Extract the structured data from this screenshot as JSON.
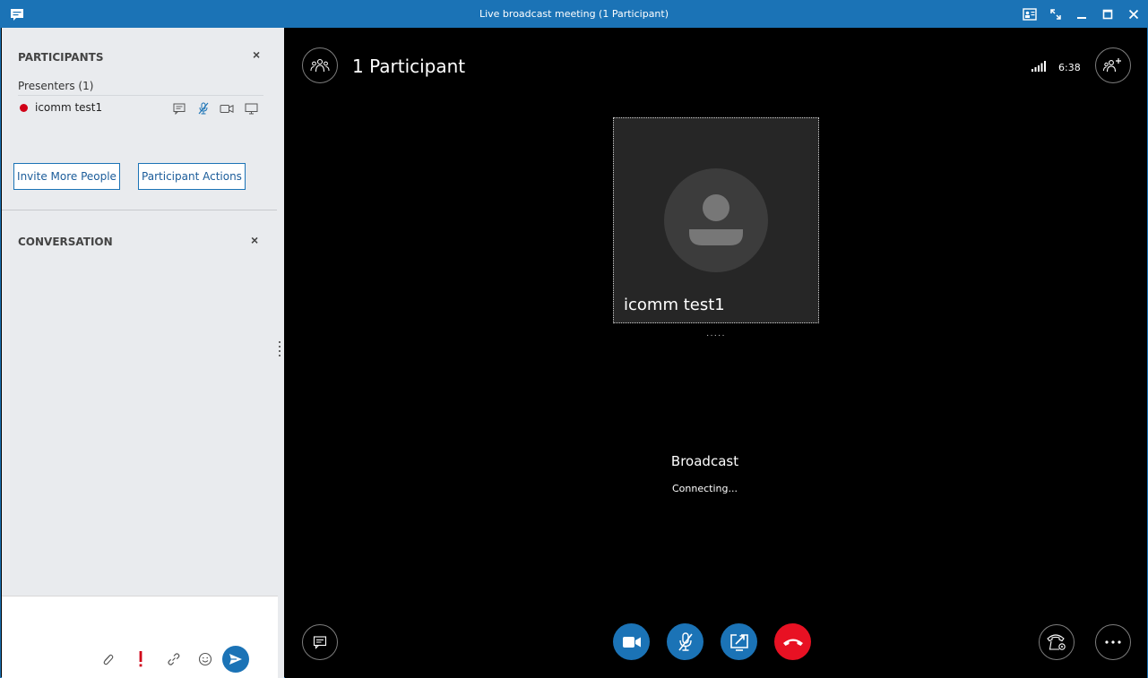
{
  "window": {
    "title": "Live broadcast meeting (1 Participant)"
  },
  "participants_panel": {
    "heading": "PARTICIPANTS",
    "close": "×",
    "presenters_label": "Presenters (1)",
    "participants": [
      {
        "name": "icomm test1",
        "status_color": "#d00017"
      }
    ],
    "invite_button": "Invite More People",
    "actions_button": "Participant Actions"
  },
  "conversation_panel": {
    "heading": "CONVERSATION",
    "close": "×",
    "compose_icons": [
      "attachment-icon",
      "importance-icon",
      "link-icon",
      "emoticon-icon",
      "send-icon"
    ]
  },
  "stage": {
    "participant_count": "1 Participant",
    "call_timer": "6:38",
    "tile_name": "icomm test1",
    "broadcast_title": "Broadcast",
    "broadcast_status": "Connecting...",
    "controls": [
      {
        "name": "video",
        "color": "#1b73b6"
      },
      {
        "name": "mute",
        "color": "#1b73b6"
      },
      {
        "name": "share",
        "color": "#1b73b6"
      },
      {
        "name": "hang-up",
        "color": "#e81123"
      }
    ]
  },
  "colors": {
    "accent": "#1b73b6",
    "hangup": "#e81123",
    "panel_bg": "#e9ebee",
    "stage_bg": "#000000"
  }
}
